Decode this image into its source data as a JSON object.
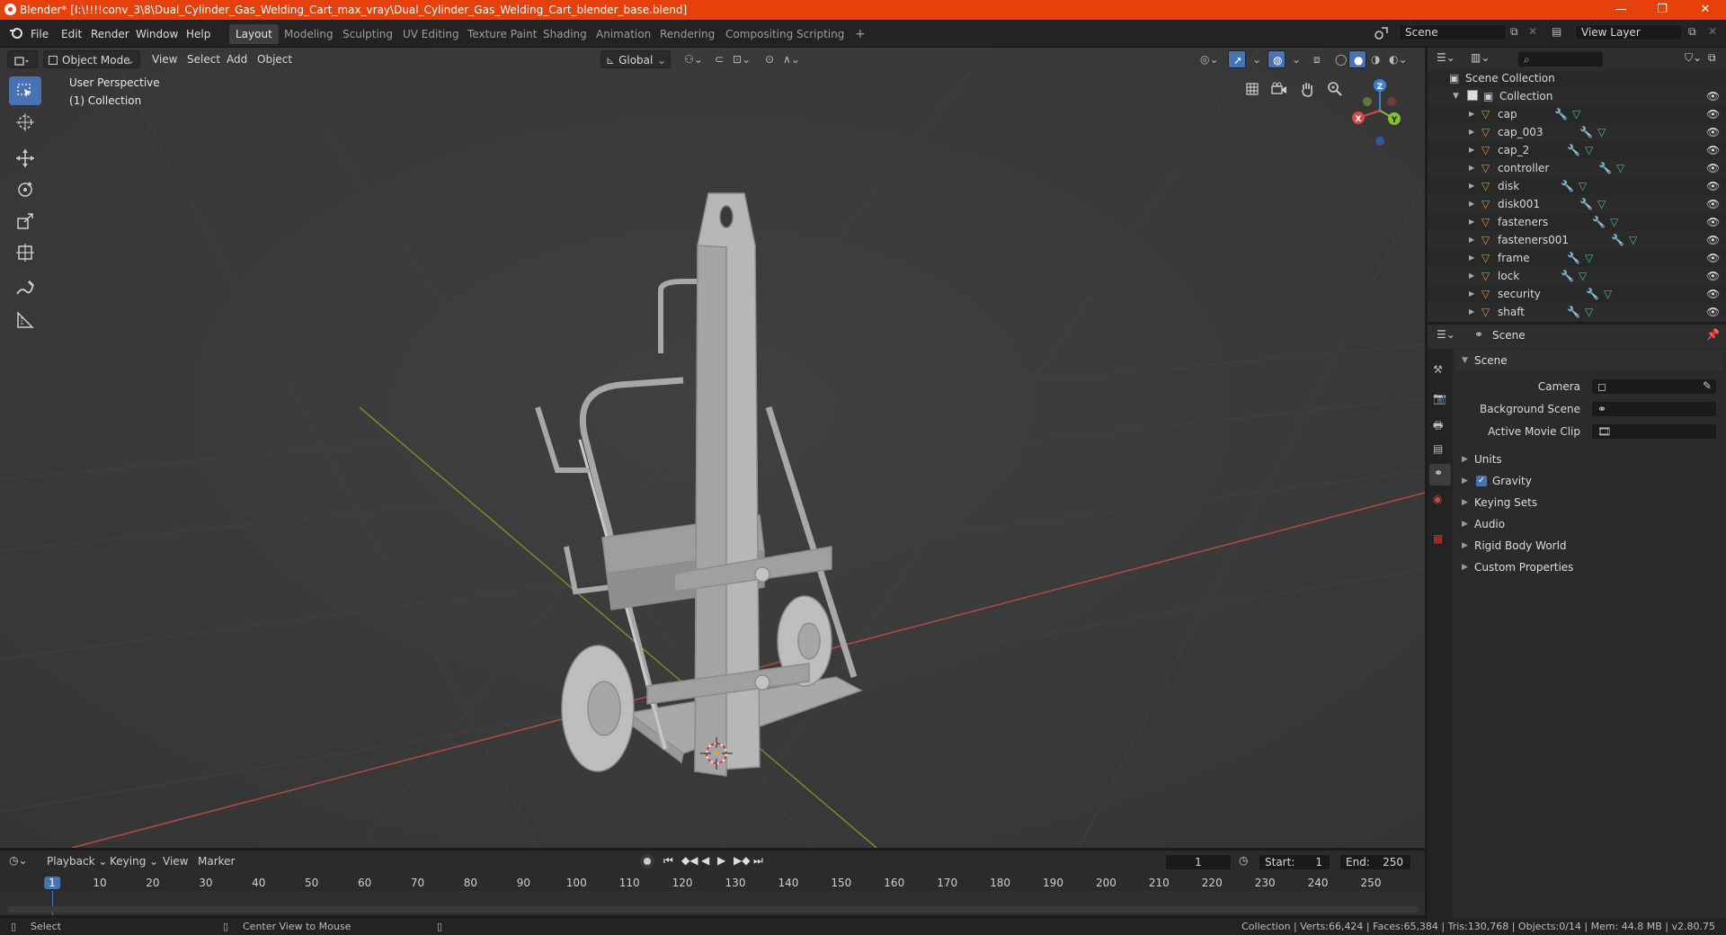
{
  "titlebar": {
    "title": "Blender* [I:\\!!!!conv_3\\8\\Dual_Cylinder_Gas_Welding_Cart_max_vray\\Dual_Cylinder_Gas_Welding_Cart_blender_base.blend]",
    "minimize": "—",
    "maximize": "❐",
    "close": "✕"
  },
  "menus": [
    "File",
    "Edit",
    "Render",
    "Window",
    "Help"
  ],
  "workspaces": [
    "Layout",
    "Modeling",
    "Sculpting",
    "UV Editing",
    "Texture Paint",
    "Shading",
    "Animation",
    "Rendering",
    "Compositing",
    "Scripting",
    "+"
  ],
  "scene_field": "Scene",
  "view_layer_field": "View Layer",
  "viewport_header": {
    "mode": "Object Mode",
    "view": "View",
    "select": "Select",
    "add": "Add",
    "object": "Object",
    "orientation": "Global"
  },
  "viewport": {
    "perspective": "User Perspective",
    "collection": "(1) Collection",
    "gizmo": {
      "x": "X",
      "y": "Y",
      "z": "Z"
    }
  },
  "outliner": {
    "scene_collection": "Scene Collection",
    "collection": "Collection",
    "items": [
      "cap",
      "cap_003",
      "cap_2",
      "controller",
      "disk",
      "disk001",
      "fasteners",
      "fasteners001",
      "frame",
      "lock",
      "security",
      "shaft"
    ]
  },
  "properties": {
    "header": "Scene",
    "panel": "Scene",
    "camera_label": "Camera",
    "background_scene_label": "Background Scene",
    "active_movie_clip_label": "Active Movie Clip",
    "subpanels": [
      "Units",
      "Gravity",
      "Keying Sets",
      "Audio",
      "Rigid Body World",
      "Custom Properties"
    ],
    "gravity_checked": true
  },
  "timeline": {
    "playback": "Playback",
    "keying": "Keying",
    "view": "View",
    "marker": "Marker",
    "current_frame": "1",
    "start_label": "Start:",
    "start": "1",
    "end_label": "End:",
    "end": "250",
    "ticks": [
      "1",
      "10",
      "20",
      "30",
      "40",
      "50",
      "60",
      "70",
      "80",
      "90",
      "100",
      "110",
      "120",
      "130",
      "140",
      "150",
      "160",
      "170",
      "180",
      "190",
      "200",
      "210",
      "220",
      "230",
      "240",
      "250"
    ]
  },
  "statusbar": {
    "select": "Select",
    "center_view": "Center View to Mouse",
    "stats": "Collection | Verts:66,424 | Faces:65,384 | Tris:130,768 | Objects:0/14 | Mem: 44.8 MB | v2.80.75"
  },
  "colors": {
    "titlebar": "#e6400c",
    "accent": "#4772b3",
    "x_axis": "#c94a4a",
    "y_axis": "#7aa02a",
    "mesh_orange": "#e0913c",
    "data_green": "#3fbf8e"
  }
}
